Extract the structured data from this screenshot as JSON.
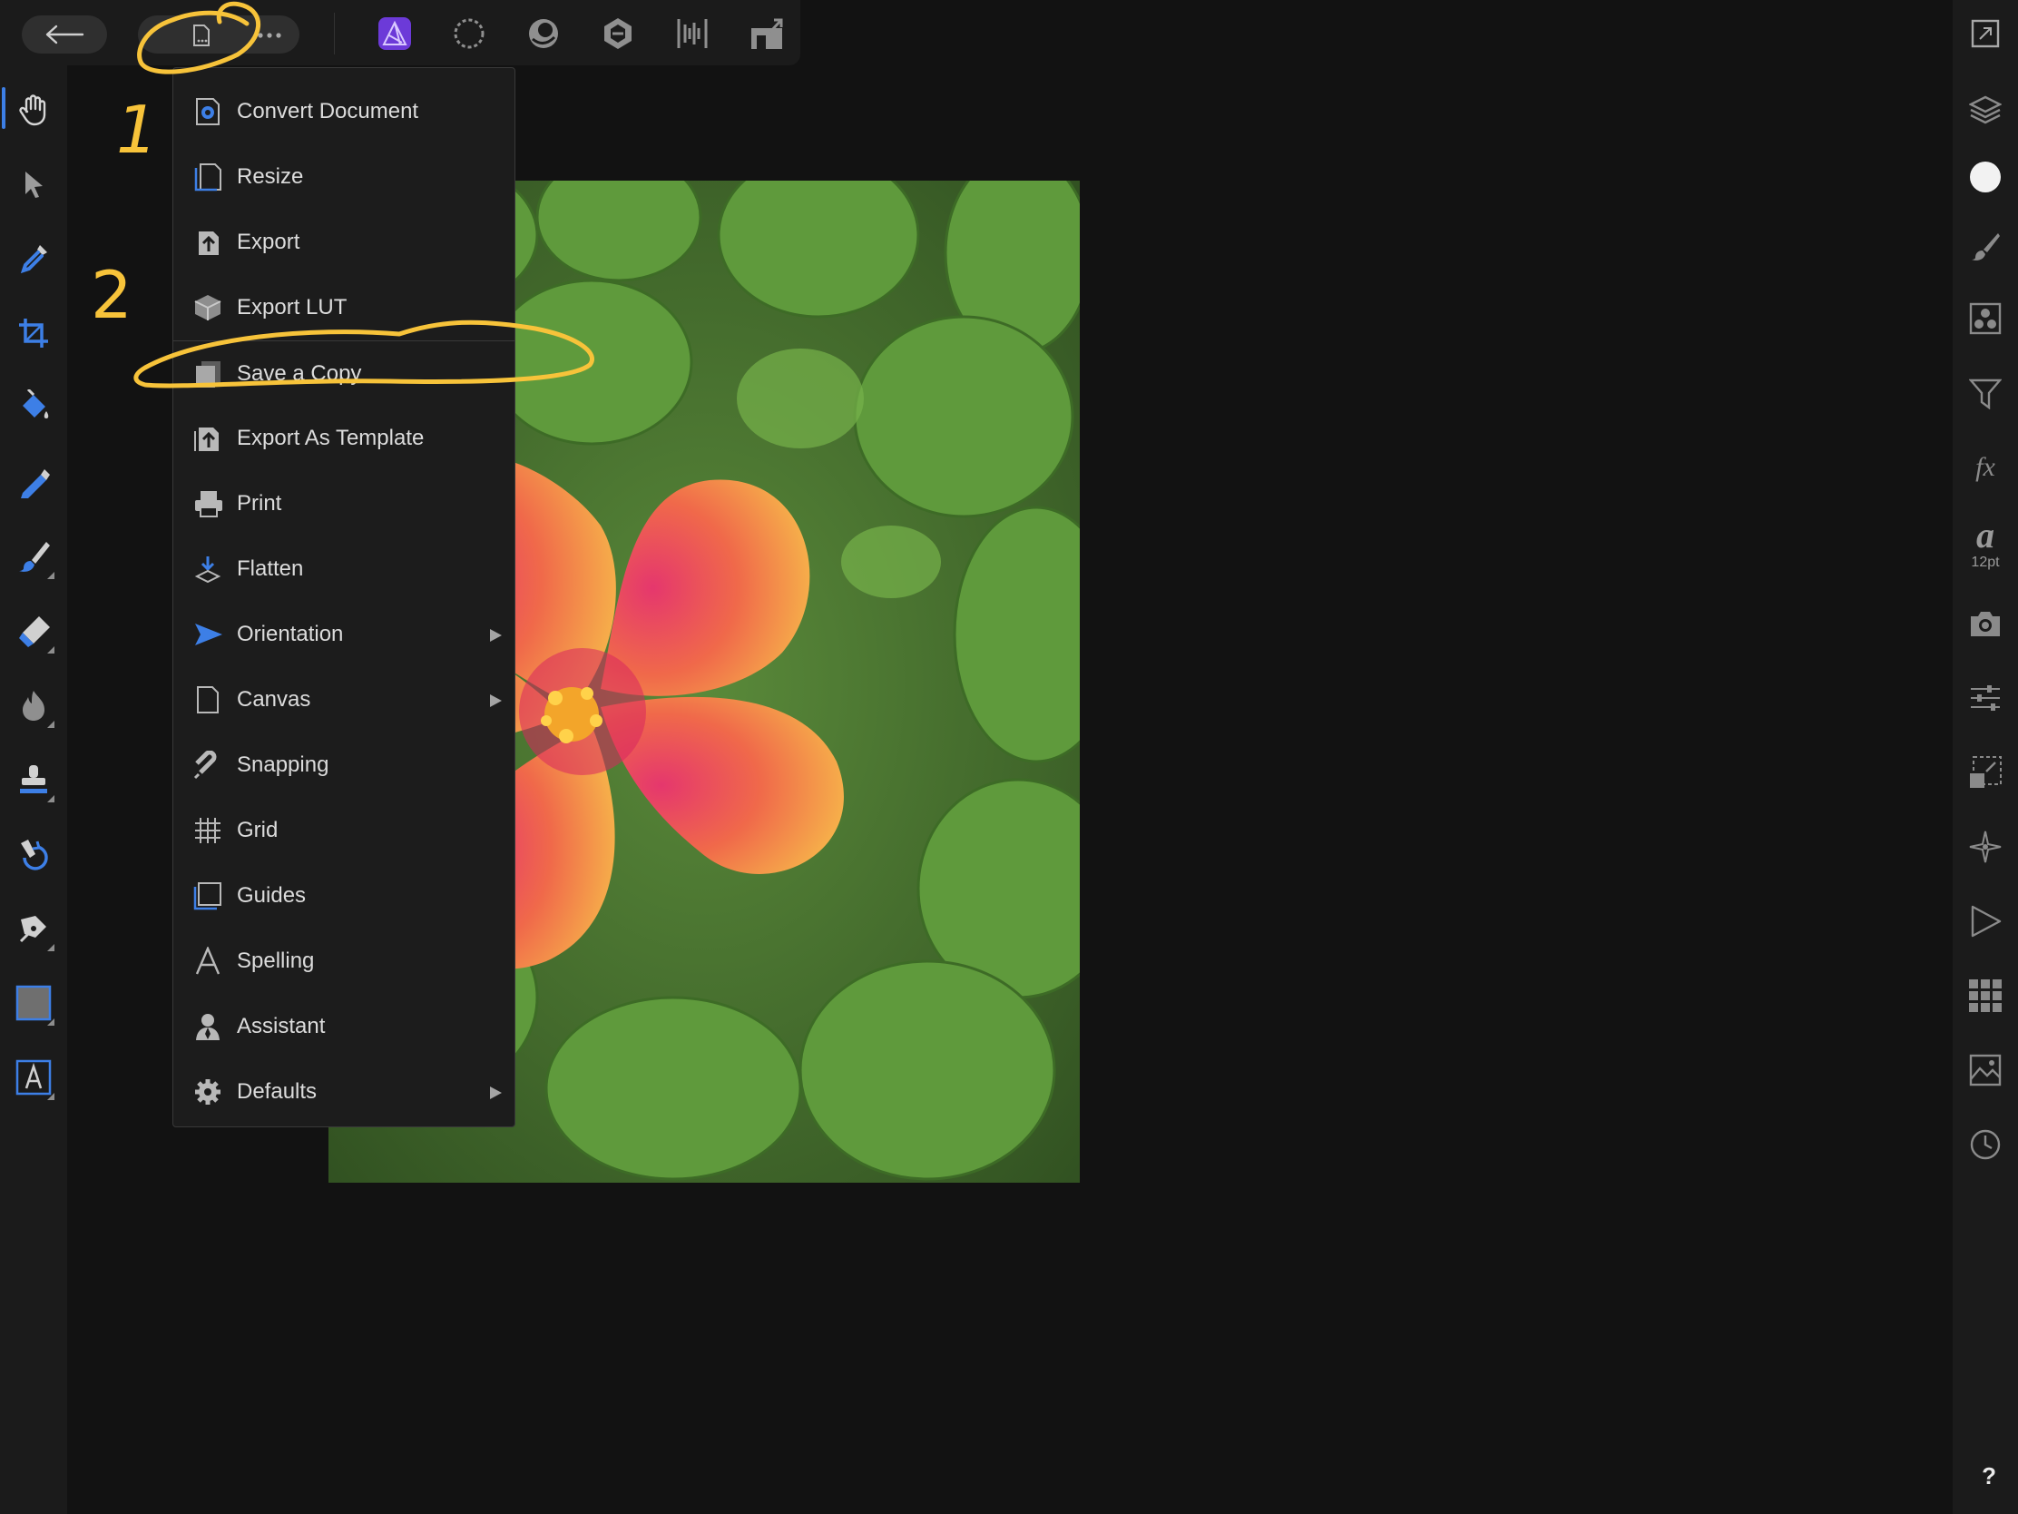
{
  "colors": {
    "accent_blue": "#3d7fe6",
    "annotation_yellow": "#f7c33a",
    "menu_bg": "#1c1c1c",
    "panel_bg": "#1b1b1b",
    "canvas_bg": "#121212"
  },
  "toolbar": {
    "icons": [
      "back-arrow-icon",
      "document-menu-icon",
      "more-icon",
      "photo-persona-icon",
      "liquify-persona-icon",
      "develop-persona-icon",
      "tone-mapping-persona-icon",
      "export-persona-icon",
      "share-icon"
    ]
  },
  "left_tools": [
    "hand-icon",
    "move-icon",
    "color-picker-icon",
    "crop-icon",
    "flood-fill-icon",
    "selection-brush-icon",
    "paint-brush-icon",
    "erase-brush-icon",
    "burn-brush-icon",
    "clone-stamp-icon",
    "inpainting-icon",
    "pen-icon",
    "rectangle-icon",
    "artistic-text-icon"
  ],
  "right_tools": {
    "icons": [
      "view-mode-icon",
      "layers-icon",
      "color-icon",
      "brushes-icon",
      "channels-icon",
      "adjustments-icon",
      "effects-icon",
      "character-icon",
      "snapshots-icon",
      "levels-icon",
      "transform-icon",
      "navigator-icon",
      "macros-icon",
      "swatches-icon",
      "library-icon",
      "history-icon"
    ],
    "fx_label": "fx",
    "char_label": "a",
    "char_size": "12pt",
    "help_label": "?"
  },
  "menu": {
    "items": [
      {
        "label": "Convert Document",
        "icon": "convert-document-icon",
        "submenu": false
      },
      {
        "label": "Resize",
        "icon": "resize-icon",
        "submenu": false
      },
      {
        "label": "Export",
        "icon": "export-icon",
        "submenu": false
      },
      {
        "label": "Export LUT",
        "icon": "export-lut-icon",
        "submenu": false
      },
      {
        "label": "Save a Copy",
        "icon": "save-copy-icon",
        "submenu": false
      },
      {
        "label": "Export As Template",
        "icon": "export-template-icon",
        "submenu": false
      },
      {
        "label": "Print",
        "icon": "print-icon",
        "submenu": false
      },
      {
        "label": "Flatten",
        "icon": "flatten-icon",
        "submenu": false
      },
      {
        "label": "Orientation",
        "icon": "orientation-icon",
        "submenu": true
      },
      {
        "label": "Canvas",
        "icon": "canvas-icon",
        "submenu": true
      },
      {
        "label": "Snapping",
        "icon": "snapping-icon",
        "submenu": false
      },
      {
        "label": "Grid",
        "icon": "grid-icon",
        "submenu": false
      },
      {
        "label": "Guides",
        "icon": "guides-icon",
        "submenu": false
      },
      {
        "label": "Spelling",
        "icon": "spelling-icon",
        "submenu": false
      },
      {
        "label": "Assistant",
        "icon": "assistant-icon",
        "submenu": false
      },
      {
        "label": "Defaults",
        "icon": "defaults-icon",
        "submenu": true
      }
    ]
  },
  "annotations": {
    "step1": "1",
    "step2": "2"
  }
}
